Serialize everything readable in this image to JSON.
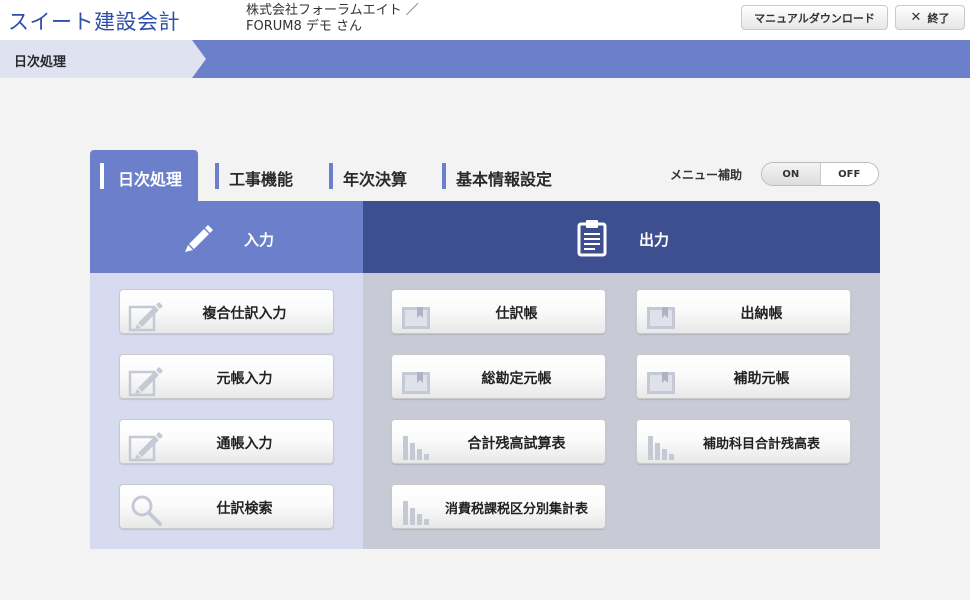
{
  "app": {
    "title": "スイート建設会計"
  },
  "user": {
    "line1": "株式会社フォーラムエイト ／",
    "line2": "FORUM8 デモ さん"
  },
  "header": {
    "manual_label": "マニュアルダウンロード",
    "exit_icon": "✕",
    "exit_label": "終了"
  },
  "breadcrumb": {
    "current": "日次処理"
  },
  "tabs": [
    {
      "label": "日次処理",
      "active": true
    },
    {
      "label": "工事機能"
    },
    {
      "label": "年次決算"
    },
    {
      "label": "基本情報設定"
    }
  ],
  "menu_aid": {
    "label": "メニュー補助",
    "on": "ON",
    "off": "OFF",
    "selected": "ON"
  },
  "input_section": {
    "label": "入力",
    "icon": "pencil-icon",
    "buttons": [
      {
        "label": "複合仕訳入力",
        "icon": "edit-icon"
      },
      {
        "label": "元帳入力",
        "icon": "edit-icon"
      },
      {
        "label": "通帳入力",
        "icon": "edit-icon"
      },
      {
        "label": "仕訳検索",
        "icon": "search-icon"
      }
    ]
  },
  "output_section": {
    "label": "出力",
    "icon": "clipboard-icon",
    "buttons": [
      {
        "label": "仕訳帳",
        "icon": "book-icon"
      },
      {
        "label": "出納帳",
        "icon": "book-icon"
      },
      {
        "label": "総勘定元帳",
        "icon": "book-icon"
      },
      {
        "label": "補助元帳",
        "icon": "book-icon"
      },
      {
        "label": "合計残高試算表",
        "icon": "bar-chart-icon"
      },
      {
        "label": "補助科目合計残高表",
        "icon": "bar-chart-icon"
      },
      {
        "label": "消費税課税区分別集計表",
        "icon": "bar-chart-icon"
      }
    ]
  },
  "colors": {
    "accent": "#6b7fca",
    "dark": "#3d4f8f",
    "title": "#2f4eab"
  }
}
